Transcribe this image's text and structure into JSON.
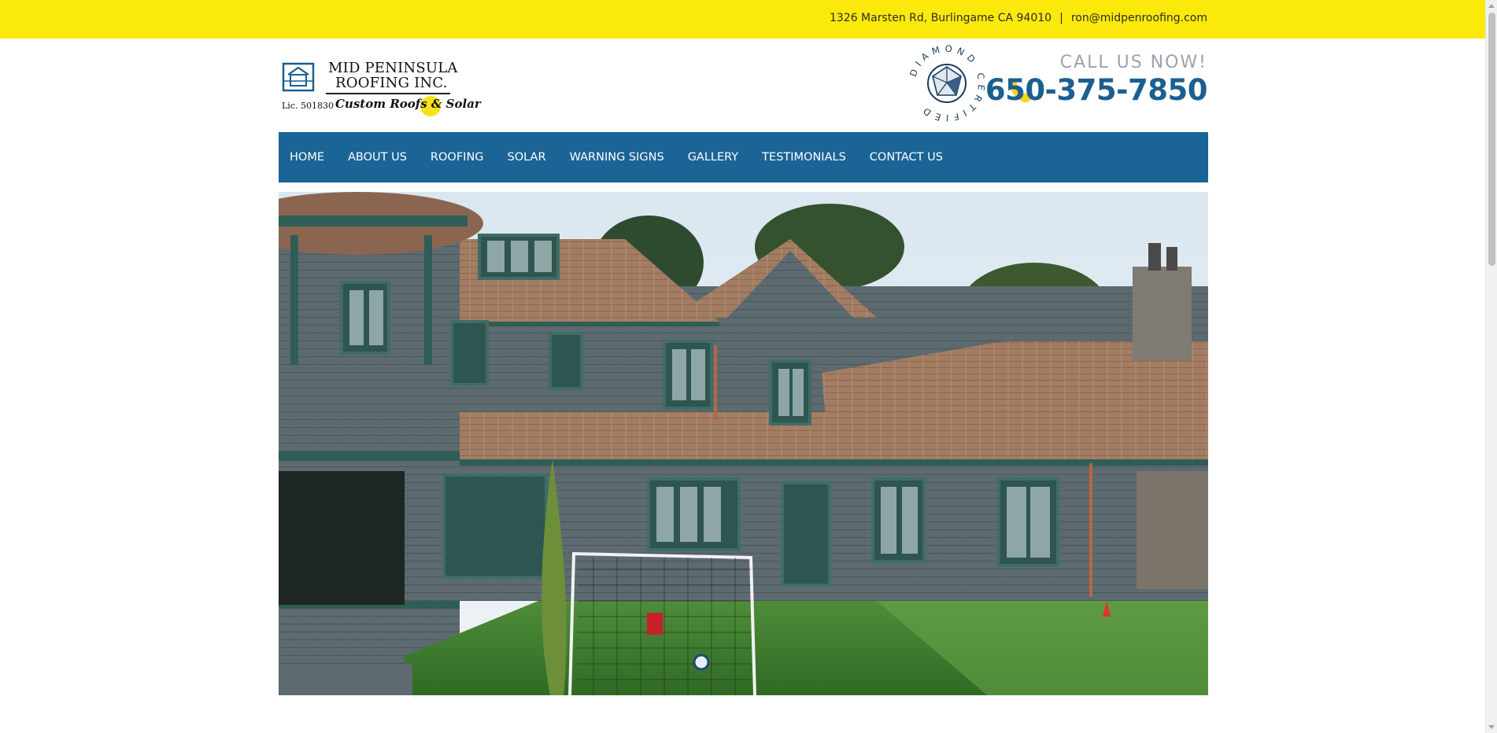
{
  "topbar": {
    "address": "1326 Marsten Rd, Burlingame CA 94010",
    "separator": "|",
    "email": "ron@midpenroofing.com"
  },
  "logo": {
    "line1": "MID PENINSULA",
    "line2": "ROOFING INC.",
    "license": "Lic. 501830",
    "tagline": "Custom Roofs & Solar"
  },
  "badge": {
    "text": "DIAMOND CERTIFIED"
  },
  "contact": {
    "call_label": "CALL US NOW!",
    "phone": "650-375-7850"
  },
  "nav": {
    "items": [
      "HOME",
      "ABOUT US",
      "ROOFING",
      "SOLAR",
      "WARNING SIGNS",
      "GALLERY",
      "TESTIMONIALS",
      "CONTACT US"
    ]
  },
  "colors": {
    "topbar": "#fbe90c",
    "nav": "#1b6496",
    "phone": "#1b5f91",
    "callnow": "#9aa3ad"
  },
  "icons": {
    "phone": "phone-icon",
    "house": "house-logo-icon"
  }
}
